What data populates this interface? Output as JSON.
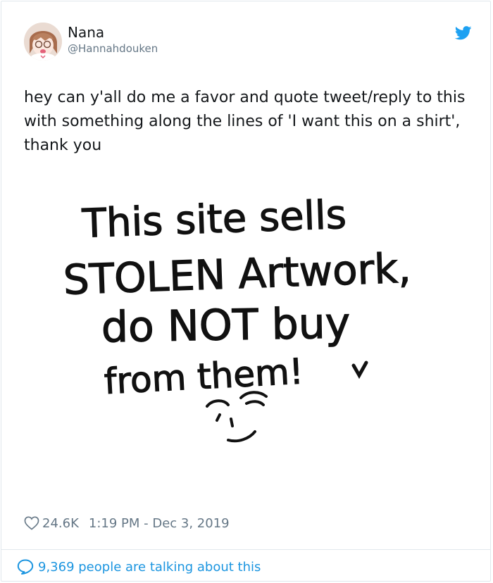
{
  "tweet": {
    "display_name": "Nana",
    "handle": "@Hannahdouken",
    "text": "hey can y'all do me a favor and quote tweet/reply to this with something along the lines of 'I want this on a shirt', thank you",
    "image_lines": [
      "This site sells",
      "STOLEN Artwork,",
      "do NOT buy",
      "from them!"
    ],
    "likes": "24.6K",
    "timestamp": "1:19 PM - Dec 3, 2019",
    "talking": "9,369 people are talking about this"
  },
  "colors": {
    "twitter_blue": "#1da1f2",
    "link_blue": "#1b95e0",
    "muted": "#657786",
    "border": "#e1e8ed"
  },
  "icons": [
    "twitter-bird-icon",
    "heart-icon",
    "speech-bubble-icon"
  ]
}
